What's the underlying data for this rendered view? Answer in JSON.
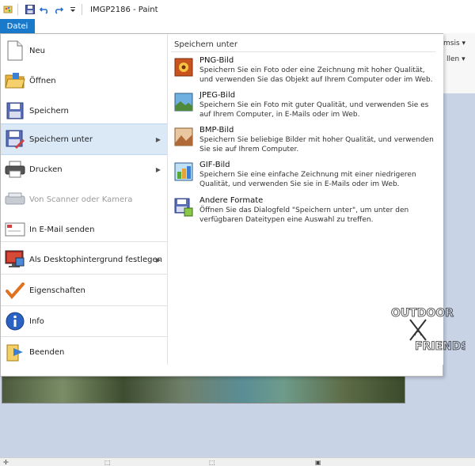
{
  "window": {
    "title": "IMGP2186 - Paint"
  },
  "ribbon": {
    "datei_tab": "Datei",
    "right_labels": [
      "msis",
      "llen"
    ]
  },
  "menu_left": {
    "items": [
      {
        "label": "Neu",
        "icon": "new-document-icon"
      },
      {
        "label": "Öffnen",
        "icon": "open-folder-icon"
      },
      {
        "label": "Speichern",
        "icon": "save-icon"
      },
      {
        "label": "Speichern unter",
        "icon": "save-as-icon",
        "selected": true,
        "submenu": true
      },
      {
        "label": "Drucken",
        "icon": "printer-icon",
        "submenu": true
      },
      {
        "label": "Von Scanner oder Kamera",
        "icon": "scanner-icon",
        "disabled": true
      },
      {
        "label": "In E-Mail senden",
        "icon": "email-icon"
      },
      {
        "label": "Als Desktophintergrund festlegen",
        "icon": "desktop-background-icon",
        "submenu": true
      },
      {
        "label": "Eigenschaften",
        "icon": "checkmark-icon"
      },
      {
        "label": "Info",
        "icon": "info-icon"
      },
      {
        "label": "Beenden",
        "icon": "exit-icon"
      }
    ]
  },
  "menu_right": {
    "title": "Speichern unter",
    "formats": [
      {
        "title": "PNG-Bild",
        "desc": "Speichern Sie ein Foto oder eine Zeichnung mit hoher Qualität, und verwenden Sie das Objekt auf Ihrem Computer oder im Web.",
        "icon": "png-icon"
      },
      {
        "title": "JPEG-Bild",
        "desc": "Speichern Sie ein Foto mit guter Qualität, und verwenden Sie es auf Ihrem Computer, in E-Mails oder im Web.",
        "icon": "jpeg-icon"
      },
      {
        "title": "BMP-Bild",
        "desc": "Speichern Sie beliebige Bilder mit hoher Qualität, und verwenden Sie sie auf Ihrem Computer.",
        "icon": "bmp-icon"
      },
      {
        "title": "GIF-Bild",
        "desc": "Speichern Sie eine einfache Zeichnung mit einer niedrigeren Qualität, und verwenden Sie sie in E-Mails oder im Web.",
        "icon": "gif-icon"
      },
      {
        "title": "Andere Formate",
        "desc": "Öffnen Sie das Dialogfeld \"Speichern unter\", um unter den verfügbaren Dateitypen eine Auswahl zu treffen.",
        "icon": "other-formats-icon"
      }
    ]
  },
  "watermark": {
    "line1": "OUTDOOR",
    "line2": "FRIENDS"
  },
  "status": {
    "cells": [
      "",
      "",
      "",
      ""
    ]
  }
}
